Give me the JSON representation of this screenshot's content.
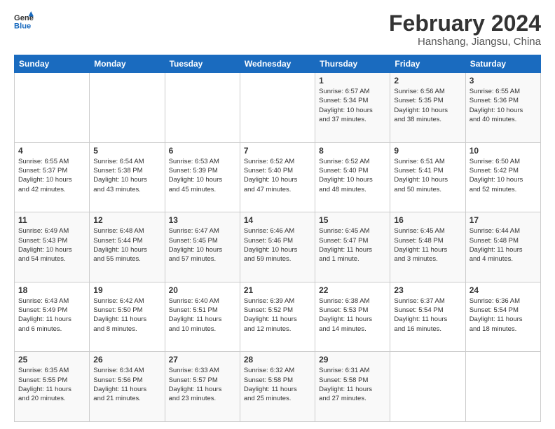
{
  "logo": {
    "line1": "General",
    "line2": "Blue"
  },
  "title": "February 2024",
  "location": "Hanshang, Jiangsu, China",
  "days_of_week": [
    "Sunday",
    "Monday",
    "Tuesday",
    "Wednesday",
    "Thursday",
    "Friday",
    "Saturday"
  ],
  "weeks": [
    [
      {
        "day": "",
        "info": ""
      },
      {
        "day": "",
        "info": ""
      },
      {
        "day": "",
        "info": ""
      },
      {
        "day": "",
        "info": ""
      },
      {
        "day": "1",
        "info": "Sunrise: 6:57 AM\nSunset: 5:34 PM\nDaylight: 10 hours\nand 37 minutes."
      },
      {
        "day": "2",
        "info": "Sunrise: 6:56 AM\nSunset: 5:35 PM\nDaylight: 10 hours\nand 38 minutes."
      },
      {
        "day": "3",
        "info": "Sunrise: 6:55 AM\nSunset: 5:36 PM\nDaylight: 10 hours\nand 40 minutes."
      }
    ],
    [
      {
        "day": "4",
        "info": "Sunrise: 6:55 AM\nSunset: 5:37 PM\nDaylight: 10 hours\nand 42 minutes."
      },
      {
        "day": "5",
        "info": "Sunrise: 6:54 AM\nSunset: 5:38 PM\nDaylight: 10 hours\nand 43 minutes."
      },
      {
        "day": "6",
        "info": "Sunrise: 6:53 AM\nSunset: 5:39 PM\nDaylight: 10 hours\nand 45 minutes."
      },
      {
        "day": "7",
        "info": "Sunrise: 6:52 AM\nSunset: 5:40 PM\nDaylight: 10 hours\nand 47 minutes."
      },
      {
        "day": "8",
        "info": "Sunrise: 6:52 AM\nSunset: 5:40 PM\nDaylight: 10 hours\nand 48 minutes."
      },
      {
        "day": "9",
        "info": "Sunrise: 6:51 AM\nSunset: 5:41 PM\nDaylight: 10 hours\nand 50 minutes."
      },
      {
        "day": "10",
        "info": "Sunrise: 6:50 AM\nSunset: 5:42 PM\nDaylight: 10 hours\nand 52 minutes."
      }
    ],
    [
      {
        "day": "11",
        "info": "Sunrise: 6:49 AM\nSunset: 5:43 PM\nDaylight: 10 hours\nand 54 minutes."
      },
      {
        "day": "12",
        "info": "Sunrise: 6:48 AM\nSunset: 5:44 PM\nDaylight: 10 hours\nand 55 minutes."
      },
      {
        "day": "13",
        "info": "Sunrise: 6:47 AM\nSunset: 5:45 PM\nDaylight: 10 hours\nand 57 minutes."
      },
      {
        "day": "14",
        "info": "Sunrise: 6:46 AM\nSunset: 5:46 PM\nDaylight: 10 hours\nand 59 minutes."
      },
      {
        "day": "15",
        "info": "Sunrise: 6:45 AM\nSunset: 5:47 PM\nDaylight: 11 hours\nand 1 minute."
      },
      {
        "day": "16",
        "info": "Sunrise: 6:45 AM\nSunset: 5:48 PM\nDaylight: 11 hours\nand 3 minutes."
      },
      {
        "day": "17",
        "info": "Sunrise: 6:44 AM\nSunset: 5:48 PM\nDaylight: 11 hours\nand 4 minutes."
      }
    ],
    [
      {
        "day": "18",
        "info": "Sunrise: 6:43 AM\nSunset: 5:49 PM\nDaylight: 11 hours\nand 6 minutes."
      },
      {
        "day": "19",
        "info": "Sunrise: 6:42 AM\nSunset: 5:50 PM\nDaylight: 11 hours\nand 8 minutes."
      },
      {
        "day": "20",
        "info": "Sunrise: 6:40 AM\nSunset: 5:51 PM\nDaylight: 11 hours\nand 10 minutes."
      },
      {
        "day": "21",
        "info": "Sunrise: 6:39 AM\nSunset: 5:52 PM\nDaylight: 11 hours\nand 12 minutes."
      },
      {
        "day": "22",
        "info": "Sunrise: 6:38 AM\nSunset: 5:53 PM\nDaylight: 11 hours\nand 14 minutes."
      },
      {
        "day": "23",
        "info": "Sunrise: 6:37 AM\nSunset: 5:54 PM\nDaylight: 11 hours\nand 16 minutes."
      },
      {
        "day": "24",
        "info": "Sunrise: 6:36 AM\nSunset: 5:54 PM\nDaylight: 11 hours\nand 18 minutes."
      }
    ],
    [
      {
        "day": "25",
        "info": "Sunrise: 6:35 AM\nSunset: 5:55 PM\nDaylight: 11 hours\nand 20 minutes."
      },
      {
        "day": "26",
        "info": "Sunrise: 6:34 AM\nSunset: 5:56 PM\nDaylight: 11 hours\nand 21 minutes."
      },
      {
        "day": "27",
        "info": "Sunrise: 6:33 AM\nSunset: 5:57 PM\nDaylight: 11 hours\nand 23 minutes."
      },
      {
        "day": "28",
        "info": "Sunrise: 6:32 AM\nSunset: 5:58 PM\nDaylight: 11 hours\nand 25 minutes."
      },
      {
        "day": "29",
        "info": "Sunrise: 6:31 AM\nSunset: 5:58 PM\nDaylight: 11 hours\nand 27 minutes."
      },
      {
        "day": "",
        "info": ""
      },
      {
        "day": "",
        "info": ""
      }
    ]
  ]
}
